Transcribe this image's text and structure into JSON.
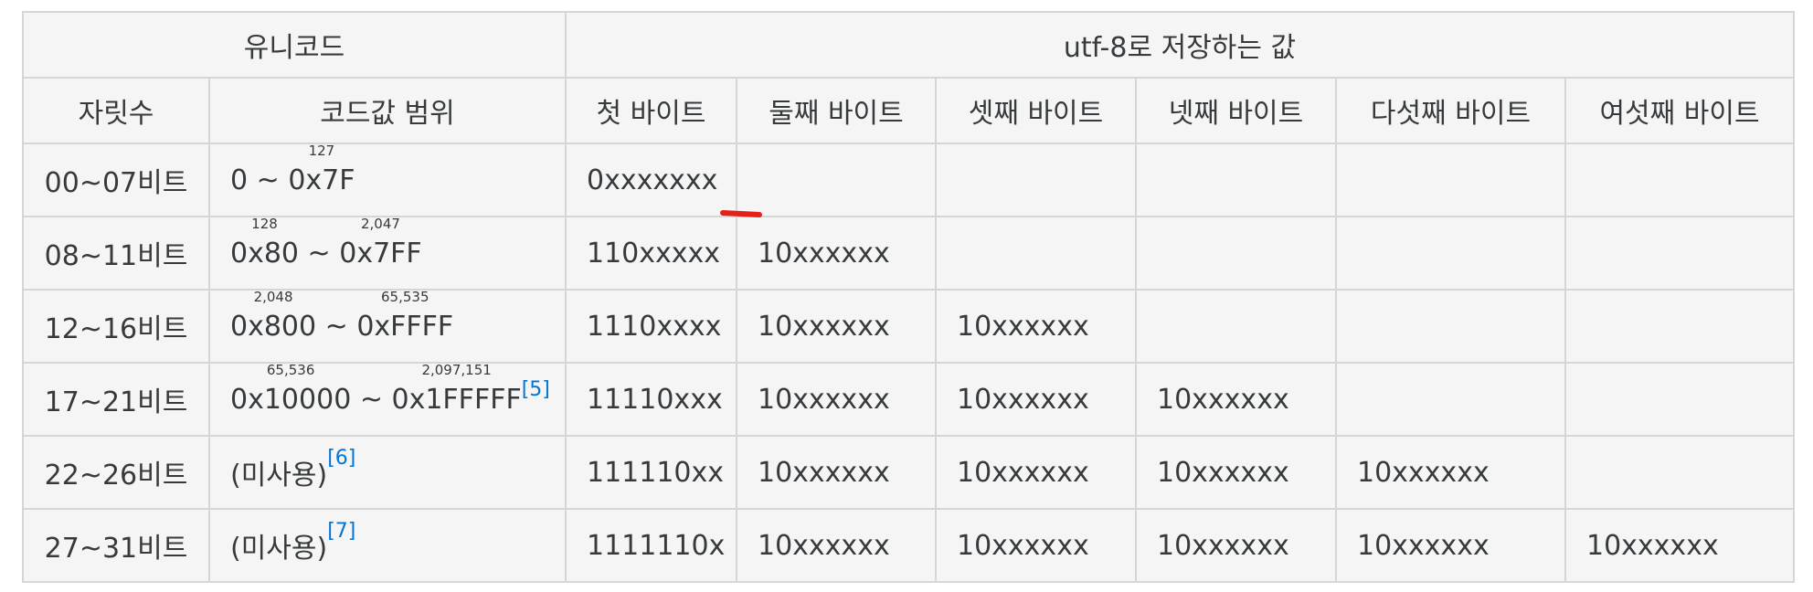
{
  "header": {
    "unicode": "유니코드",
    "utf8": "utf-8로 저장하는 값",
    "bits": "자릿수",
    "range": "코드값 범위",
    "b1": "첫 바이트",
    "b2": "둘째 바이트",
    "b3": "셋째 바이트",
    "b4": "넷째 바이트",
    "b5": "다섯째 바이트",
    "b6": "여섯째 바이트"
  },
  "rows": [
    {
      "bits": "00~07비트",
      "range_a": "0",
      "sup_a": "",
      "tilde": " ~ ",
      "range_b": "0x7F",
      "sup_b": "127",
      "ref": "",
      "bytes": [
        "0xxxxxxx",
        "",
        "",
        "",
        "",
        ""
      ]
    },
    {
      "bits": "08~11비트",
      "range_a": "0x80",
      "sup_a": "128",
      "tilde": " ~ ",
      "range_b": "0x7FF",
      "sup_b": "2,047",
      "ref": "",
      "bytes": [
        "110xxxxx",
        "10xxxxxx",
        "",
        "",
        "",
        ""
      ]
    },
    {
      "bits": "12~16비트",
      "range_a": "0x800",
      "sup_a": "2,048",
      "tilde": " ~ ",
      "range_b": "0xFFFF",
      "sup_b": "65,535",
      "ref": "",
      "bytes": [
        "1110xxxx",
        "10xxxxxx",
        "10xxxxxx",
        "",
        "",
        ""
      ]
    },
    {
      "bits": "17~21비트",
      "range_a": "0x10000",
      "sup_a": "65,536",
      "tilde": " ~ ",
      "range_b": "0x1FFFFF",
      "sup_b": "2,097,151",
      "ref": "[5]",
      "bytes": [
        "11110xxx",
        "10xxxxxx",
        "10xxxxxx",
        "10xxxxxx",
        "",
        ""
      ]
    },
    {
      "bits": "22~26비트",
      "range_text": "(미사용)",
      "ref": "[6]",
      "bytes": [
        "111110xx",
        "10xxxxxx",
        "10xxxxxx",
        "10xxxxxx",
        "10xxxxxx",
        ""
      ]
    },
    {
      "bits": "27~31비트",
      "range_text": "(미사용)",
      "ref": "[7]",
      "bytes": [
        "1111110x",
        "10xxxxxx",
        "10xxxxxx",
        "10xxxxxx",
        "10xxxxxx",
        "10xxxxxx"
      ]
    }
  ],
  "colors": {
    "link": "#0275d8",
    "annotation": "#e32119",
    "cell_bg": "#f5f5f5",
    "border": "#d6d6d6"
  }
}
